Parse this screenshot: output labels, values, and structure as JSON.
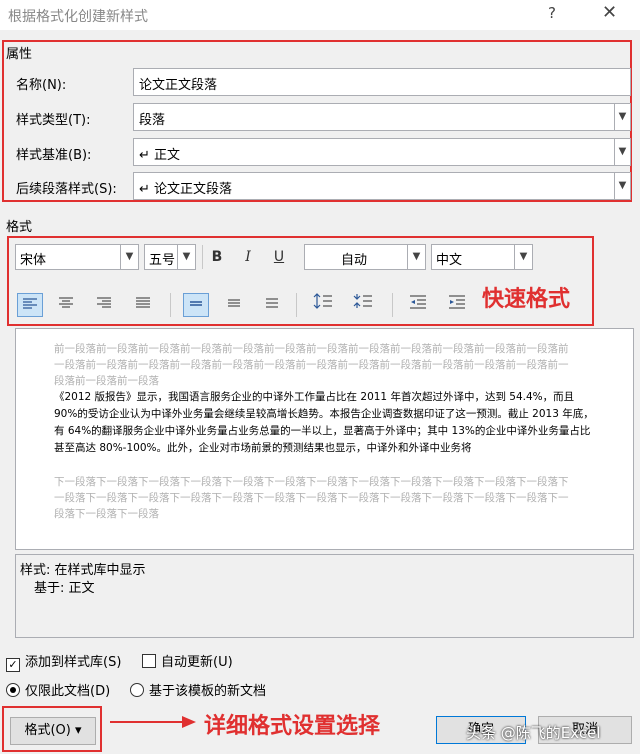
{
  "window": {
    "title": "根据格式化创建新样式",
    "help": "?",
    "close": "✕"
  },
  "properties": {
    "section_label": "属性",
    "rows": [
      {
        "label": "名称(N):",
        "value": "论文正文段落",
        "has_arrow": false
      },
      {
        "label": "样式类型(T):",
        "value": "段落",
        "has_arrow": true
      },
      {
        "label": "样式基准(B):",
        "value": "↵ 正文",
        "has_arrow": true
      },
      {
        "label": "后续段落样式(S):",
        "value": "↵ 论文正文段落",
        "has_arrow": true
      }
    ]
  },
  "format": {
    "section_label": "格式",
    "font": "宋体",
    "size": "五号",
    "bold": "B",
    "italic": "I",
    "underline": "U",
    "color": "自动",
    "script": "中文"
  },
  "preview": {
    "before": "前一段落前一段落前一段落前一段落前一段落前一段落前一段落前一段落前一段落前一段落前一段落前一段落前一段落前一段落前一段落前一段落前一段落前一段落前一段落前一段落前一段落前一段落前一段落前一段落前一段落前一段落前一段落",
    "body": "《2012 版报告》显示，我国语言服务企业的中译外工作量占比在 2011 年首次超过外译中，达到 54.4%，而且 90%的受访企业认为中译外业务量会继续呈较高增长趋势。本报告企业调查数据印证了这一预测。截止 2013 年底，有 64%的翻译服务企业中译外业务量占业务总量的一半以上，显著高于外译中；其中 13%的企业中译外业务量占比甚至高达 80%-100%。此外，企业对市场前景的预测结果也显示，中译外和外译中业务将",
    "after": "下一段落下一段落下一段落下一段落下一段落下一段落下一段落下一段落下一段落下一段落下一段落下一段落下一段落下一段落下一段落下一段落下一段落下一段落下一段落下一段落下一段落下一段落下一段落下一段落下一段落下一段落下一段落"
  },
  "description": {
    "line1": "样式: 在样式库中显示",
    "line2": "基于: 正文"
  },
  "options": {
    "add_to_gallery": "添加到样式库(S)",
    "auto_update": "自动更新(U)",
    "this_doc_only": "仅限此文档(D)",
    "new_docs_template": "基于该模板的新文档"
  },
  "buttons": {
    "format": "格式(O)",
    "format_arrow": "▾",
    "ok": "确定",
    "cancel": "取消"
  },
  "annotations": {
    "quick_format": "快速格式",
    "detailed_format": "详细格式设置选择"
  },
  "watermark": "头条 @陈飞的Excel",
  "colors": {
    "annotation_red": "#e03030",
    "selected_blue": "#cce4f7"
  }
}
